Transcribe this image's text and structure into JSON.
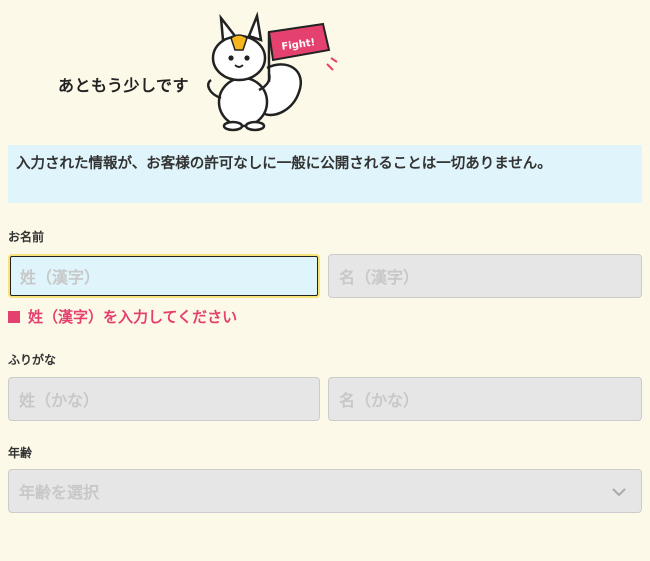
{
  "header": {
    "progress_text": "あともう少しです",
    "flag_text": "Fight!"
  },
  "notice": {
    "text": "入力された情報が、お客様の許可なしに一般に公開されることは一切ありません。"
  },
  "name": {
    "label": "お名前",
    "last_placeholder": "姓（漢字）",
    "first_placeholder": "名（漢字）",
    "error": "姓（漢字）を入力してください"
  },
  "kana": {
    "label": "ふりがな",
    "last_placeholder": "姓（かな）",
    "first_placeholder": "名（かな）"
  },
  "age": {
    "label": "年齢",
    "placeholder": "年齢を選択"
  },
  "colors": {
    "background": "#fdf9e8",
    "notice_bg": "#dff4fb",
    "error": "#e5416f",
    "flag": "#e5416f"
  }
}
